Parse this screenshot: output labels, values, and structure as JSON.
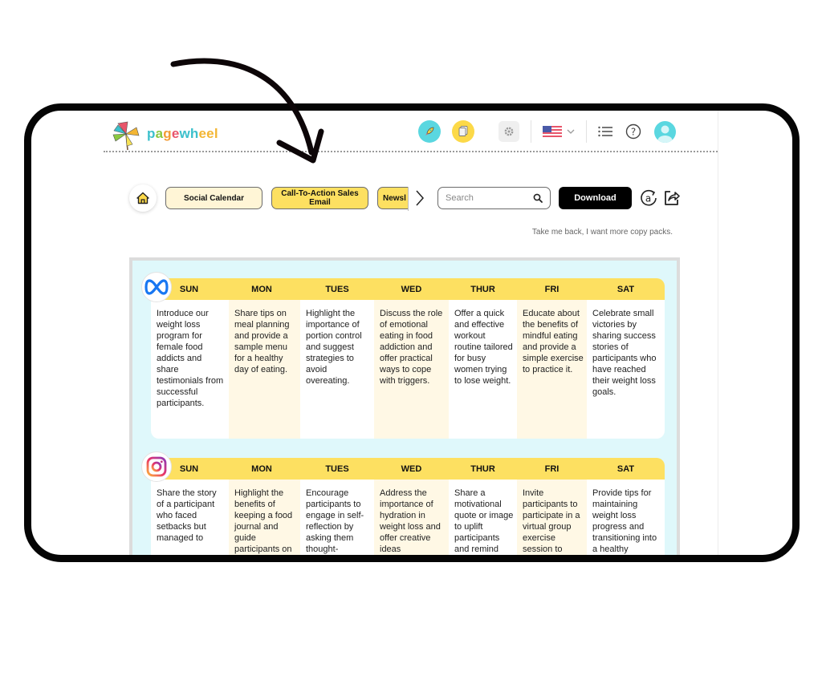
{
  "app": {
    "logo_text": [
      "p",
      "a",
      "g",
      "e",
      "wh",
      "eel"
    ],
    "header_icons": [
      "rocket-icon",
      "pages-icon",
      "gear-icon",
      "us-flag-icon",
      "chevron-down-icon",
      "list-icon",
      "help-icon",
      "avatar"
    ]
  },
  "toolbar": {
    "tabs": [
      {
        "label": "Social Calendar",
        "active": false
      },
      {
        "label": "Call-To-Action Sales Email",
        "active": true
      },
      {
        "label": "Newsl",
        "active": true
      }
    ],
    "search_placeholder": "Search",
    "search_value": "",
    "download_label": "Download",
    "take_back_link": "Take me back, I want more copy packs."
  },
  "colors": {
    "accent_yellow": "#fde061",
    "cream": "#fff8e5",
    "calendar_bg": "#dff8fb",
    "brand_teal": "#5ad7e0"
  },
  "calendar": {
    "meta": {
      "platform": "Meta",
      "days": [
        "SUN",
        "MON",
        "TUES",
        "WED",
        "THUR",
        "FRI",
        "SAT"
      ],
      "posts": [
        "Introduce our weight loss program for female food addicts and share testimonials from successful participants.",
        "Share tips on meal planning and provide a sample menu for a healthy day of eating.",
        "Highlight the importance of portion control and suggest strategies to avoid overeating.",
        "Discuss the role of emotional eating in food addiction and offer practical ways to cope with triggers.",
        "Offer a quick and effective workout routine tailored for busy women trying to lose weight.",
        "Educate about the benefits of mindful eating and provide a simple exercise to practice it.",
        "Celebrate small victories by sharing success stories of participants who have reached their weight loss goals."
      ]
    },
    "instagram": {
      "platform": "Instagram",
      "days": [
        "SUN",
        "MON",
        "TUES",
        "WED",
        "THUR",
        "FRI",
        "SAT"
      ],
      "posts": [
        "Share the story of a participant who faced setbacks but managed to",
        "Highlight the benefits of keeping a food journal and guide participants on",
        "Encourage participants to engage in self-reflection by asking them thought-",
        "Address the importance of hydration in weight loss and offer creative ideas",
        "Share a motivational quote or image to uplift participants and remind",
        "Invite participants to participate in a virtual group exercise session to",
        "Provide tips for maintaining weight loss progress and transitioning into a healthy"
      ]
    }
  }
}
